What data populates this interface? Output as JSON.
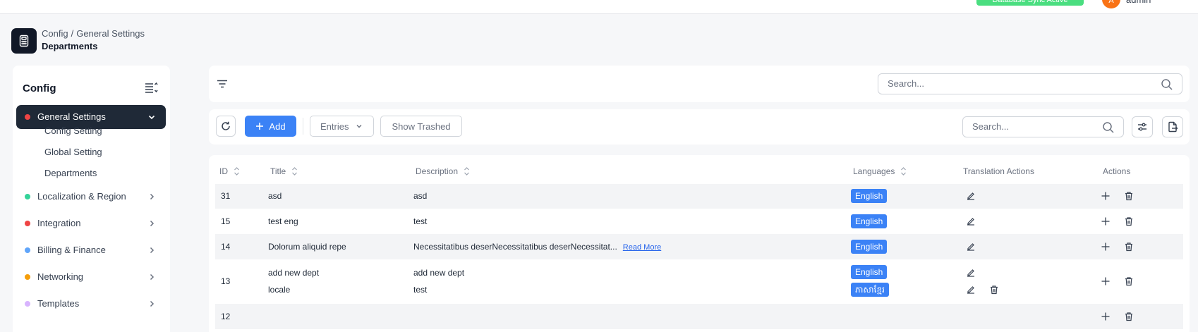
{
  "topbar": {
    "status_label": "Database Sync Active",
    "avatar_initial": "A",
    "user_name": "admin"
  },
  "header": {
    "breadcrumb": [
      "Config",
      "General Settings"
    ],
    "breadcrumb_separator": "/",
    "title": "Departments"
  },
  "sidebar": {
    "title": "Config",
    "active_item": {
      "label": "General Settings",
      "dot_color": "#ef4444"
    },
    "sub_items": [
      {
        "label": "Config Setting"
      },
      {
        "label": "Global Setting"
      },
      {
        "label": "Departments"
      }
    ],
    "items": [
      {
        "label": "Localization & Region",
        "dot_color": "#34d399"
      },
      {
        "label": "Integration",
        "dot_color": "#ef4444"
      },
      {
        "label": "Billing & Finance",
        "dot_color": "#60a5fa"
      },
      {
        "label": "Networking",
        "dot_color": "#f59e0b"
      },
      {
        "label": "Templates",
        "dot_color": "#d8b4fe"
      }
    ]
  },
  "filter_bar": {
    "search_placeholder": "Search..."
  },
  "toolbar": {
    "add_label": "Add",
    "entries_label": "Entries",
    "show_trashed_label": "Show Trashed",
    "search_placeholder": "Search..."
  },
  "table": {
    "headers": {
      "id": "ID",
      "title": "Title",
      "description": "Description",
      "languages": "Languages",
      "translation_actions": "Translation Actions",
      "actions": "Actions"
    },
    "read_more_label": "Read More",
    "rows": [
      {
        "id": "31",
        "title": "asd",
        "description": "asd",
        "language": "English"
      },
      {
        "id": "15",
        "title": "test eng",
        "description": "test",
        "language": "English"
      },
      {
        "id": "14",
        "title": "Dolorum aliquid repe",
        "description": "Necessitatibus deserNecessitatibus deserNecessitat...",
        "language": "English"
      },
      {
        "id": "13",
        "title": "add new dept",
        "description": "add new dept",
        "language": "English",
        "title_2": "locale",
        "description_2": "test",
        "language_2": "ភាសាខ្មែរ"
      },
      {
        "id": "12"
      }
    ]
  },
  "colors": {
    "accent": "#3b82f6",
    "sidebar_active_bg": "#1f2937",
    "page_bg": "#f6f7f9"
  }
}
